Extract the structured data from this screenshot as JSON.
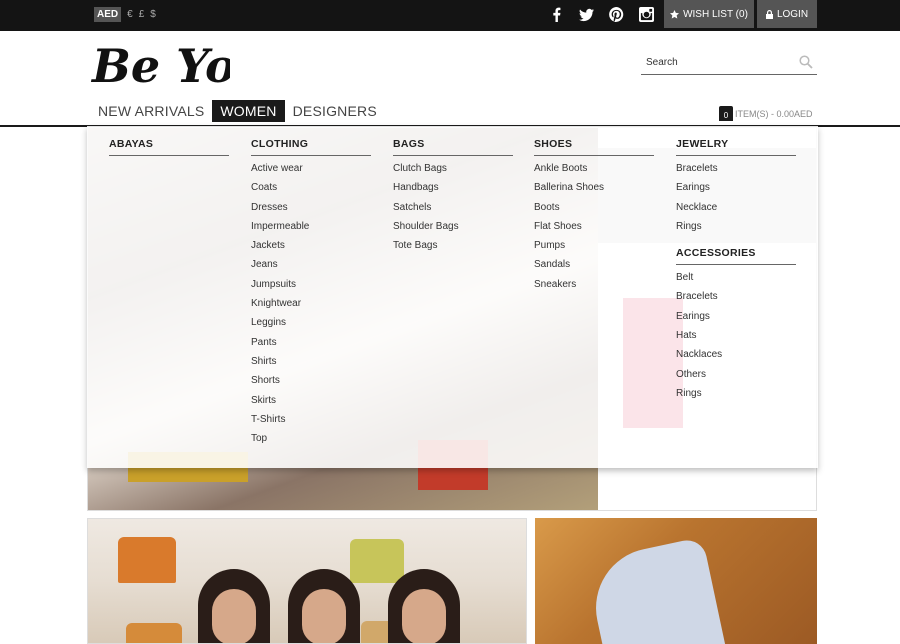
{
  "topbar": {
    "currencies": [
      "AED",
      "€",
      "£",
      "$"
    ],
    "social_icons": [
      "facebook-icon",
      "twitter-icon",
      "pinterest-icon",
      "instagram-icon"
    ],
    "wishlist_label": "WISH LIST (0)",
    "login_label": "LOGIN"
  },
  "header": {
    "logo_text": "Be You",
    "search_placeholder": "Search"
  },
  "nav": {
    "items": [
      "NEW ARRIVALS",
      "WOMEN",
      "DESIGNERS"
    ],
    "active": "WOMEN"
  },
  "cart": {
    "count": "0",
    "summary": "ITEM(S) - 0.00AED"
  },
  "menu": {
    "abayas": {
      "title": "ABAYAS",
      "items": []
    },
    "clothing": {
      "title": "CLOTHING",
      "items": [
        "Active wear",
        "Coats",
        "Dresses",
        "Impermeable",
        "Jackets",
        "Jeans",
        "Jumpsuits",
        "Knightwear",
        "Leggins",
        "Pants",
        "Shirts",
        "Shorts",
        "Skirts",
        "T-Shirts",
        "Top"
      ]
    },
    "bags": {
      "title": "BAGS",
      "items": [
        "Clutch Bags",
        "Handbags",
        "Satchels",
        "Shoulder Bags",
        "Tote Bags"
      ]
    },
    "shoes": {
      "title": "SHOES",
      "items": [
        "Ankle Boots",
        "Ballerina Shoes",
        "Boots",
        "Flat Shoes",
        "Pumps",
        "Sandals",
        "Sneakers"
      ]
    },
    "jewelry": {
      "title": "JEWELRY",
      "items": [
        "Bracelets",
        "Earings",
        "Necklace",
        "Rings"
      ]
    },
    "accessories": {
      "title": "ACCESSORIES",
      "items": [
        "Belt",
        "Bracelets",
        "Earings",
        "Hats",
        "Nacklaces",
        "Others",
        "Rings"
      ]
    }
  }
}
